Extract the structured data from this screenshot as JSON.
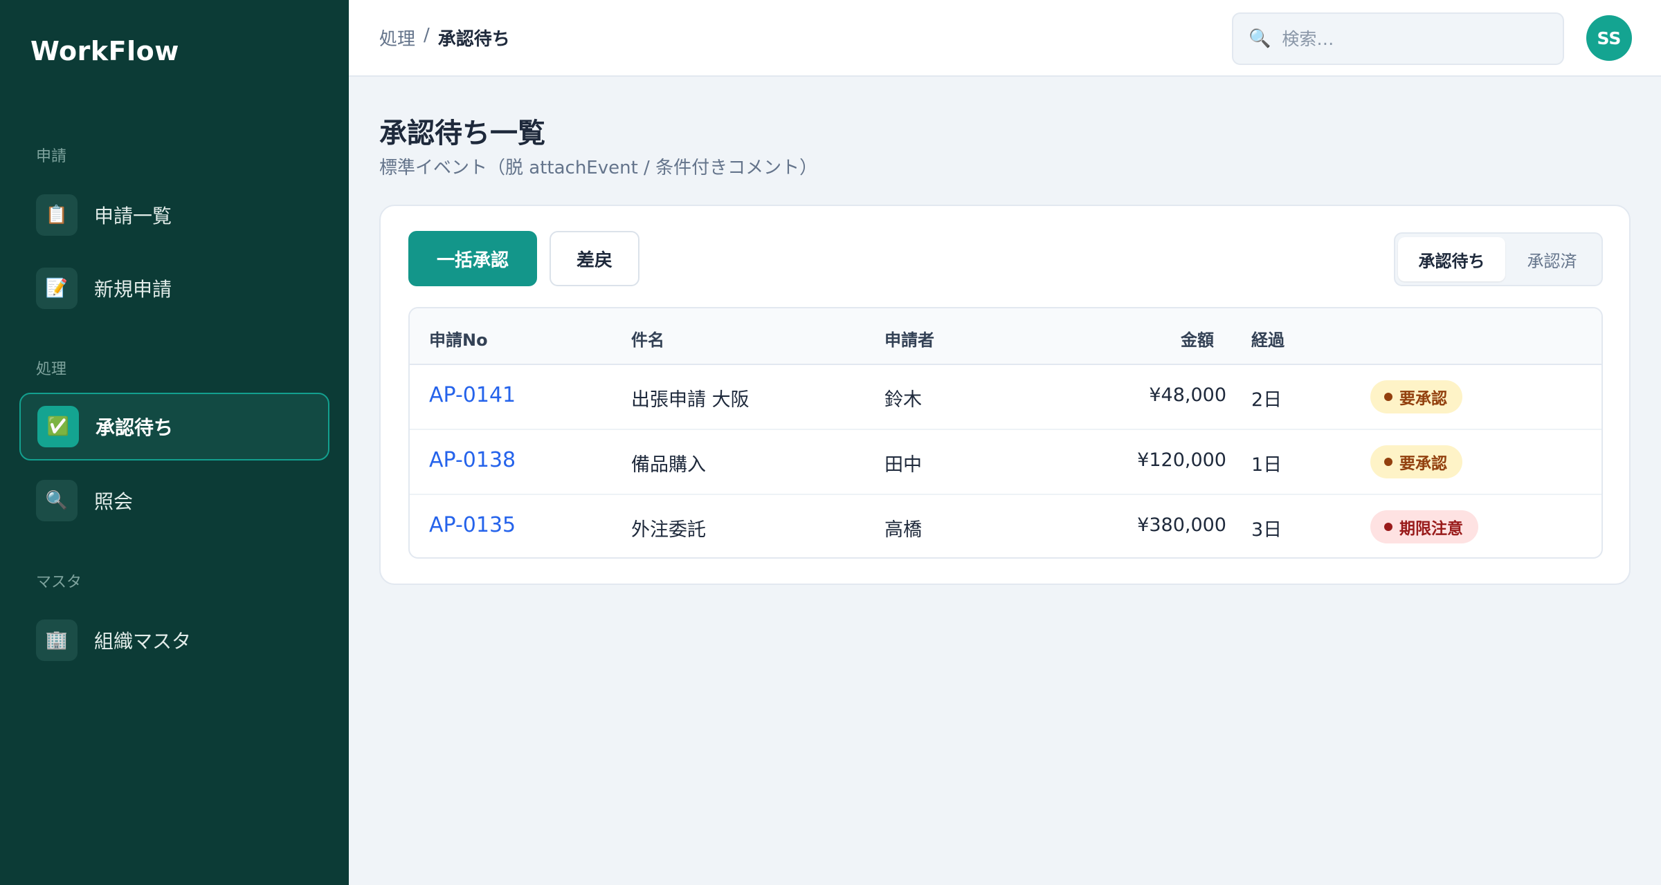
{
  "sidebar": {
    "brand": "WorkFlow",
    "sections": [
      {
        "label": "申請",
        "items": [
          {
            "label": "申請一覧",
            "icon": "📋"
          },
          {
            "label": "新規申請",
            "icon": "📝"
          }
        ]
      },
      {
        "label": "処理",
        "items": [
          {
            "label": "承認待ち",
            "icon": "✅",
            "active": true
          },
          {
            "label": "照会",
            "icon": "🔍"
          }
        ]
      },
      {
        "label": "マスタ",
        "items": [
          {
            "label": "組織マスタ",
            "icon": "🏢"
          }
        ]
      }
    ]
  },
  "topbar": {
    "breadcrumb": {
      "parent": "処理",
      "separator": "/",
      "current": "承認待ち"
    },
    "search": {
      "placeholder": "検索…",
      "icon": "🔍"
    },
    "avatar": "SS"
  },
  "main": {
    "title": "承認待ち一覧",
    "subtitle": "標準イベント（脱 attachEvent / 条件付きコメント）",
    "actions": {
      "bulk_approve": "一括承認",
      "send_back": "差戻"
    },
    "tabs": [
      {
        "label": "承認待ち",
        "selected": true
      },
      {
        "label": "承認済",
        "selected": false
      }
    ],
    "table": {
      "columns": {
        "no": "申請No",
        "subject": "件名",
        "applicant": "申請者",
        "amount": "金額",
        "elapsed": "経過"
      },
      "rows": [
        {
          "no": "AP-0141",
          "subject": "出張申請 大阪",
          "applicant": "鈴木",
          "amount": "¥48,000",
          "elapsed": "2日",
          "status": "要承認",
          "status_type": "warn"
        },
        {
          "no": "AP-0138",
          "subject": "備品購入",
          "applicant": "田中",
          "amount": "¥120,000",
          "elapsed": "1日",
          "status": "要承認",
          "status_type": "warn"
        },
        {
          "no": "AP-0135",
          "subject": "外注委託",
          "applicant": "高橋",
          "amount": "¥380,000",
          "elapsed": "3日",
          "status": "期限注意",
          "status_type": "danger"
        }
      ]
    }
  },
  "colors": {
    "sidebar_bg": "#0c3b36",
    "accent": "#14a491",
    "primary_button": "#13968a",
    "link": "#2563eb"
  }
}
